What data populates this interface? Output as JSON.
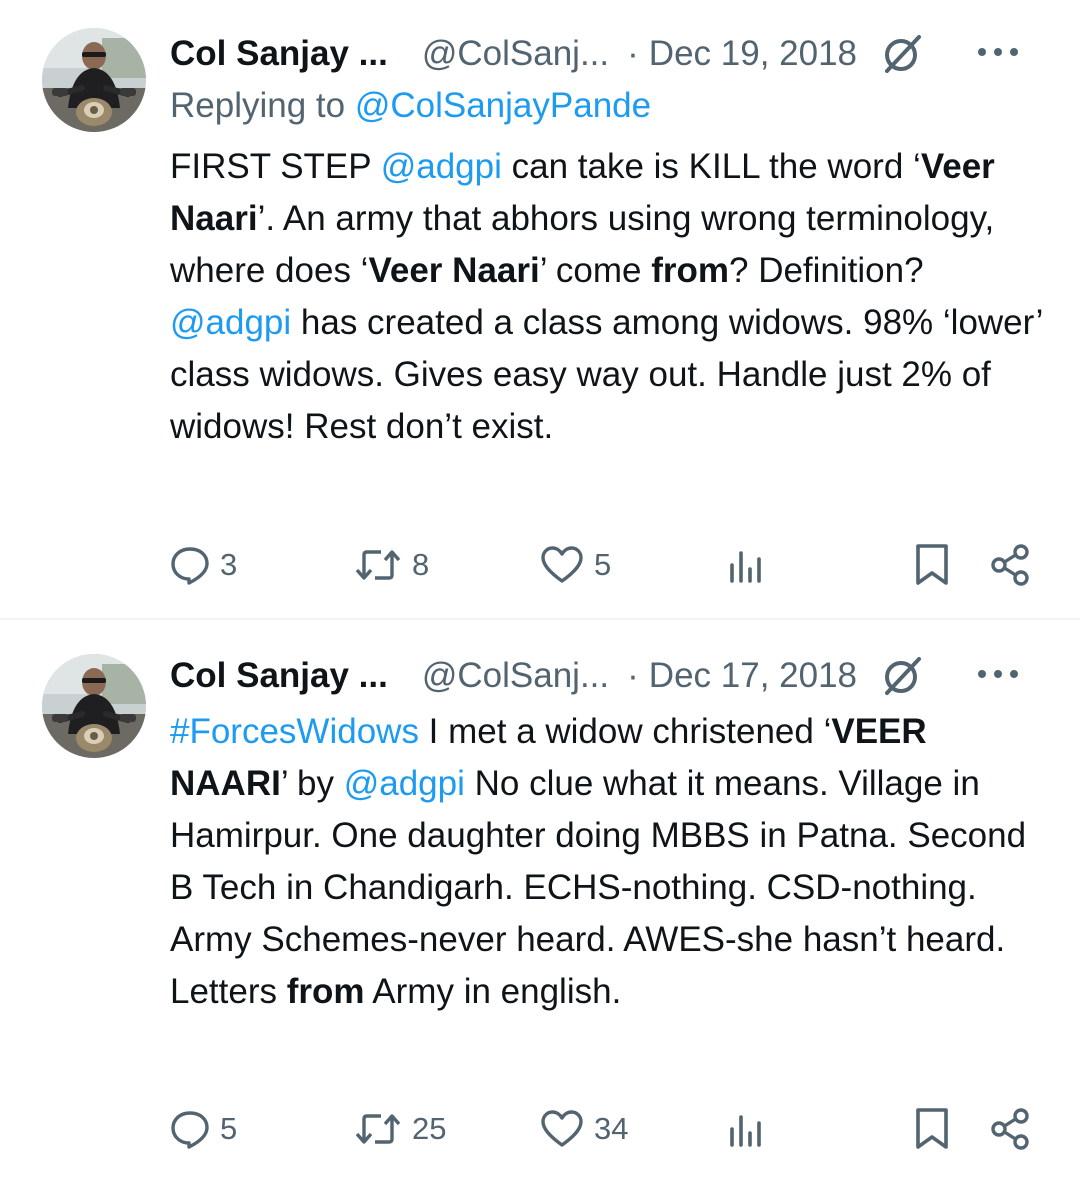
{
  "tweets": [
    {
      "author_name": "Col Sanjay ...",
      "handle": "@ColSanj...",
      "separator": "·",
      "date": "Dec 19, 2018",
      "replying_to_prefix": "Replying to ",
      "replying_to_handle": "@ColSanjayPande",
      "body": {
        "s1": "FIRST STEP ",
        "m1": "@adgpi",
        "s2": " can take is KILL the word ‘",
        "b1": "Veer Naari",
        "s3": "’. An army that abhors using wrong terminology, where does ‘",
        "b2": "Veer Naari",
        "s4": "’ come ",
        "b3": "from",
        "s5": "? Definition? ",
        "m2": "@adgpi",
        "s6": " has created a class among widows. 98% ‘lower’ class widows. Gives easy way out. Handle just 2% of widows! Rest don’t exist."
      },
      "replies": "3",
      "retweets": "8",
      "likes": "5"
    },
    {
      "author_name": "Col Sanjay ...",
      "handle": "@ColSanj...",
      "separator": "·",
      "date": "Dec 17, 2018",
      "body": {
        "h1": "#ForcesWidows",
        "s1": " I met a widow christened ‘",
        "b1": "VEER NAARI",
        "s2": "’ by ",
        "m1": "@adgpi",
        "s3": " No clue what it means. Village in Hamirpur. One daughter doing MBBS in Patna. Second B Tech in Chandigarh. ECHS-nothing. CSD-nothing. Army Schemes-never heard. AWES-she hasn’t heard. Letters ",
        "b2": "from",
        "s4": " Army in english."
      },
      "replies": "5",
      "retweets": "25",
      "likes": "34"
    }
  ],
  "icons": {
    "avatar": "avatar-photo",
    "verified": "slashed-circle-icon",
    "more": "more-horizontal-icon",
    "reply": "reply-bubble-icon",
    "retweet": "retweet-icon",
    "like": "heart-icon",
    "views": "views-bars-icon",
    "bookmark": "bookmark-icon",
    "share": "share-icon"
  },
  "colors": {
    "text_primary": "#0f1419",
    "text_secondary": "#536471",
    "link": "#1d9bf0",
    "divider": "#eff3f4"
  }
}
